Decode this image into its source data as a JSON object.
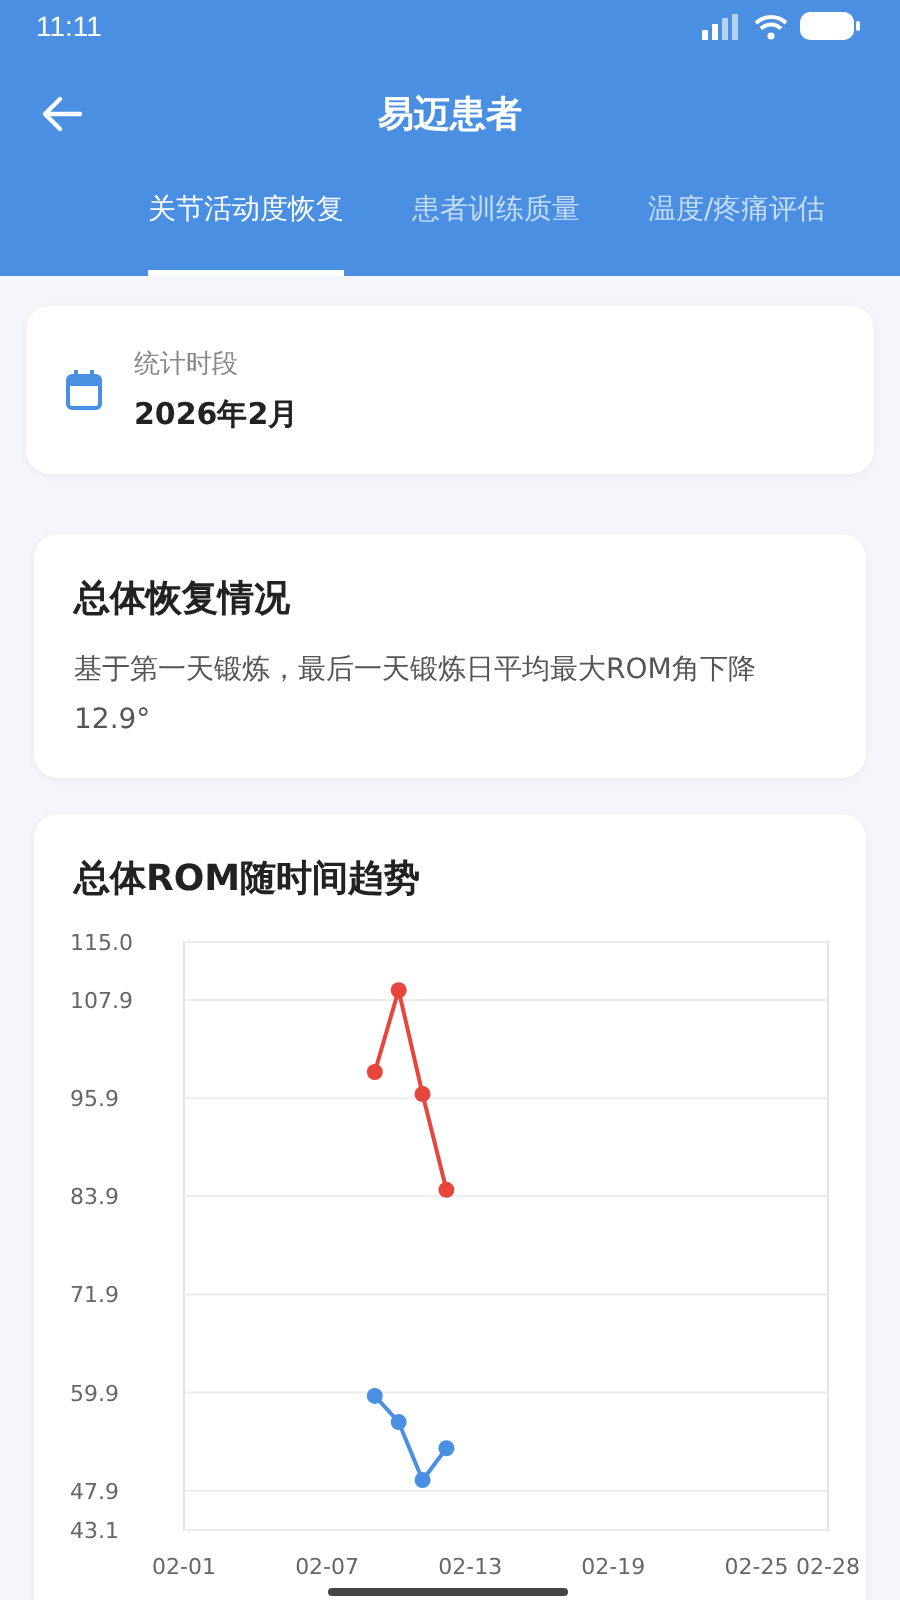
{
  "status_bar": {
    "time": "11:11"
  },
  "header": {
    "title": "易迈患者"
  },
  "tabs": [
    {
      "label": "关节活动度恢复",
      "selected": true
    },
    {
      "label": "患者训练质量",
      "selected": false
    },
    {
      "label": "温度/疼痛评估",
      "selected": false
    }
  ],
  "period": {
    "label": "统计时段",
    "value": "2026年2月"
  },
  "summary": {
    "title": "总体恢复情况",
    "text": "基于第一天锻炼，最后一天锻炼日平均最大ROM角下降12.9°"
  },
  "trend": {
    "title": "总体ROM随时间趋势",
    "chart_data": {
      "type": "line",
      "categories": [
        "02-01",
        null,
        null,
        null,
        null,
        null,
        "02-07",
        null,
        null,
        null,
        null,
        null,
        "02-13",
        null,
        null,
        null,
        null,
        null,
        "02-19",
        null,
        null,
        null,
        null,
        null,
        "02-25",
        null,
        null,
        "02-28"
      ],
      "series": [
        {
          "color": "#e8453c",
          "marker": "circle",
          "values": [
            null,
            null,
            null,
            null,
            null,
            null,
            null,
            null,
            99.1,
            109.1,
            96.4,
            84.7,
            null,
            null,
            null,
            null,
            null,
            null,
            null,
            null,
            null,
            null,
            null,
            null,
            null,
            null,
            null,
            null
          ]
        },
        {
          "color": "#4a8fe2",
          "marker": "circle",
          "values": [
            null,
            null,
            null,
            null,
            null,
            null,
            null,
            null,
            59.5,
            56.3,
            49.2,
            53.1,
            null,
            null,
            null,
            null,
            null,
            null,
            null,
            null,
            null,
            null,
            null,
            null,
            null,
            null,
            null,
            null
          ]
        }
      ],
      "grid": true,
      "ylim": [
        43.1,
        115.0
      ],
      "yticks": [
        {
          "value": 43.1,
          "label": "43.1"
        },
        {
          "value": 47.9,
          "label": "47.9"
        },
        {
          "value": 59.9,
          "label": "59.9"
        },
        {
          "value": 71.9,
          "label": "71.9"
        },
        {
          "value": 83.9,
          "label": "83.9"
        },
        {
          "value": 95.9,
          "label": "95.9"
        },
        {
          "value": 107.9,
          "label": "107.9"
        },
        {
          "value": 115.0,
          "label": "115.0"
        }
      ]
    }
  }
}
